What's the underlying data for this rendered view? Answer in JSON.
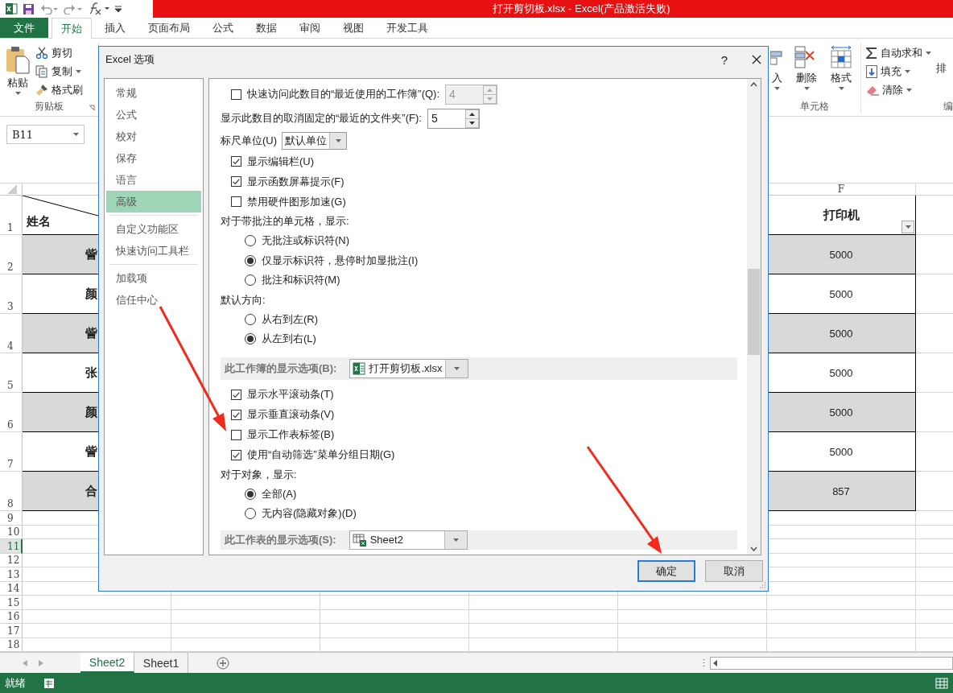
{
  "app": {
    "title": "打开剪切板.xlsx - Excel(产品激活失败)"
  },
  "ribbon_tabs": [
    {
      "label": "文件",
      "kind": "file",
      "selected": false
    },
    {
      "label": "开始",
      "kind": "tab",
      "selected": true
    },
    {
      "label": "插入",
      "kind": "tab",
      "selected": false
    },
    {
      "label": "页面布局",
      "kind": "tab",
      "selected": false
    },
    {
      "label": "公式",
      "kind": "tab",
      "selected": false
    },
    {
      "label": "数据",
      "kind": "tab",
      "selected": false
    },
    {
      "label": "审阅",
      "kind": "tab",
      "selected": false
    },
    {
      "label": "视图",
      "kind": "tab",
      "selected": false
    },
    {
      "label": "开发工具",
      "kind": "tab",
      "selected": false
    }
  ],
  "clipboard_group": {
    "paste": "粘贴",
    "cut": "剪切",
    "copy": "复制",
    "format_painter": "格式刷",
    "label": "剪贴板"
  },
  "cells_group": {
    "insert": "入",
    "delete": "删除",
    "format": "格式",
    "label": "单元格"
  },
  "editing_group": {
    "autosum": "自动求和",
    "fill": "填充",
    "clear": "清除",
    "sort": "排",
    "label": "编"
  },
  "name_box": "B11",
  "grid": {
    "column_f": "F",
    "rows": [
      {
        "number": "1",
        "kind": "header",
        "name": "姓名",
        "value": "打印机",
        "selected": false
      },
      {
        "number": "2",
        "kind": "data",
        "name": "訾",
        "value": "5000",
        "shaded": true,
        "selected": false
      },
      {
        "number": "3",
        "kind": "data",
        "name": "颜",
        "value": "5000",
        "shaded": false,
        "selected": false
      },
      {
        "number": "4",
        "kind": "data",
        "name": "訾",
        "value": "5000",
        "shaded": true,
        "selected": false
      },
      {
        "number": "5",
        "kind": "data",
        "name": "张",
        "value": "5000",
        "shaded": false,
        "selected": false
      },
      {
        "number": "6",
        "kind": "data",
        "name": "颜",
        "value": "5000",
        "shaded": true,
        "selected": false
      },
      {
        "number": "7",
        "kind": "data",
        "name": "訾",
        "value": "5000",
        "shaded": false,
        "selected": false
      },
      {
        "number": "8",
        "kind": "data",
        "name": "合",
        "value": "857",
        "shaded": true,
        "selected": false
      },
      {
        "number": "9",
        "kind": "empty",
        "selected": false
      },
      {
        "number": "10",
        "kind": "empty",
        "selected": false
      },
      {
        "number": "11",
        "kind": "empty",
        "selected": true
      },
      {
        "number": "12",
        "kind": "empty",
        "selected": false
      },
      {
        "number": "13",
        "kind": "empty",
        "selected": false
      },
      {
        "number": "14",
        "kind": "empty",
        "selected": false
      },
      {
        "number": "15",
        "kind": "empty",
        "selected": false
      },
      {
        "number": "16",
        "kind": "empty",
        "selected": false
      },
      {
        "number": "17",
        "kind": "empty",
        "selected": false
      },
      {
        "number": "18",
        "kind": "empty",
        "selected": false
      }
    ]
  },
  "sheet_tabs": [
    {
      "label": "Sheet2",
      "selected": true
    },
    {
      "label": "Sheet1",
      "selected": false
    }
  ],
  "status_bar": {
    "text": "就绪"
  },
  "dialog": {
    "title": "Excel 选项",
    "help": "?",
    "nav": [
      [
        {
          "label": "常规",
          "selected": false
        },
        {
          "label": "公式",
          "selected": false
        },
        {
          "label": "校对",
          "selected": false
        },
        {
          "label": "保存",
          "selected": false
        },
        {
          "label": "语言",
          "selected": false
        },
        {
          "label": "高级",
          "selected": true
        }
      ],
      [
        {
          "label": "自定义功能区",
          "selected": false
        },
        {
          "label": "快速访问工具栏",
          "selected": false
        }
      ],
      [
        {
          "label": "加载项",
          "selected": false
        },
        {
          "label": "信任中心",
          "selected": false
        }
      ]
    ],
    "options": [
      {
        "kind": "check_spin",
        "label": "快速访问此数目的“最近使用的工作簿”(Q):",
        "value": "4",
        "checked": false,
        "disabled": true
      },
      {
        "kind": "spin",
        "label": "显示此数目的取消固定的“最近的文件夹”(F):",
        "value": "5",
        "disabled": false
      },
      {
        "kind": "dropdown",
        "label": "标尺单位(U)",
        "value": "默认单位"
      },
      {
        "kind": "checkbox",
        "label": "显示编辑栏(U)",
        "checked": true
      },
      {
        "kind": "checkbox",
        "label": "显示函数屏幕提示(F)",
        "checked": true
      },
      {
        "kind": "checkbox",
        "label": "禁用硬件图形加速(G)",
        "checked": false
      },
      {
        "kind": "heading",
        "label": "对于带批注的单元格，显示:"
      },
      {
        "kind": "radio",
        "label": "无批注或标识符(N)",
        "selected": false
      },
      {
        "kind": "radio",
        "label": "仅显示标识符，悬停时加显批注(I)",
        "selected": true
      },
      {
        "kind": "radio",
        "label": "批注和标识符(M)",
        "selected": false
      },
      {
        "kind": "heading",
        "label": "默认方向:"
      },
      {
        "kind": "radio",
        "label": "从右到左(R)",
        "selected": false
      },
      {
        "kind": "radio",
        "label": "从左到右(L)",
        "selected": true
      },
      {
        "kind": "workbook_section",
        "label": "此工作簿的显示选项(B):",
        "value": "打开剪切板.xlsx"
      },
      {
        "kind": "checkbox",
        "label": "显示水平滚动条(T)",
        "checked": true
      },
      {
        "kind": "checkbox",
        "label": "显示垂直滚动条(V)",
        "checked": true
      },
      {
        "kind": "checkbox",
        "label": "显示工作表标签(B)",
        "checked": false
      },
      {
        "kind": "checkbox",
        "label": "使用“自动筛选”菜单分组日期(G)",
        "checked": true
      },
      {
        "kind": "heading",
        "label": "对于对象，显示:"
      },
      {
        "kind": "radio",
        "label": "全部(A)",
        "selected": true
      },
      {
        "kind": "radio",
        "label": "无内容(隐藏对象)(D)",
        "selected": false
      },
      {
        "kind": "sheet_section",
        "label": "此工作表的显示选项(S):",
        "value": "Sheet2"
      }
    ],
    "buttons": [
      {
        "label": "确定",
        "default": true
      },
      {
        "label": "取消",
        "default": false
      }
    ]
  }
}
